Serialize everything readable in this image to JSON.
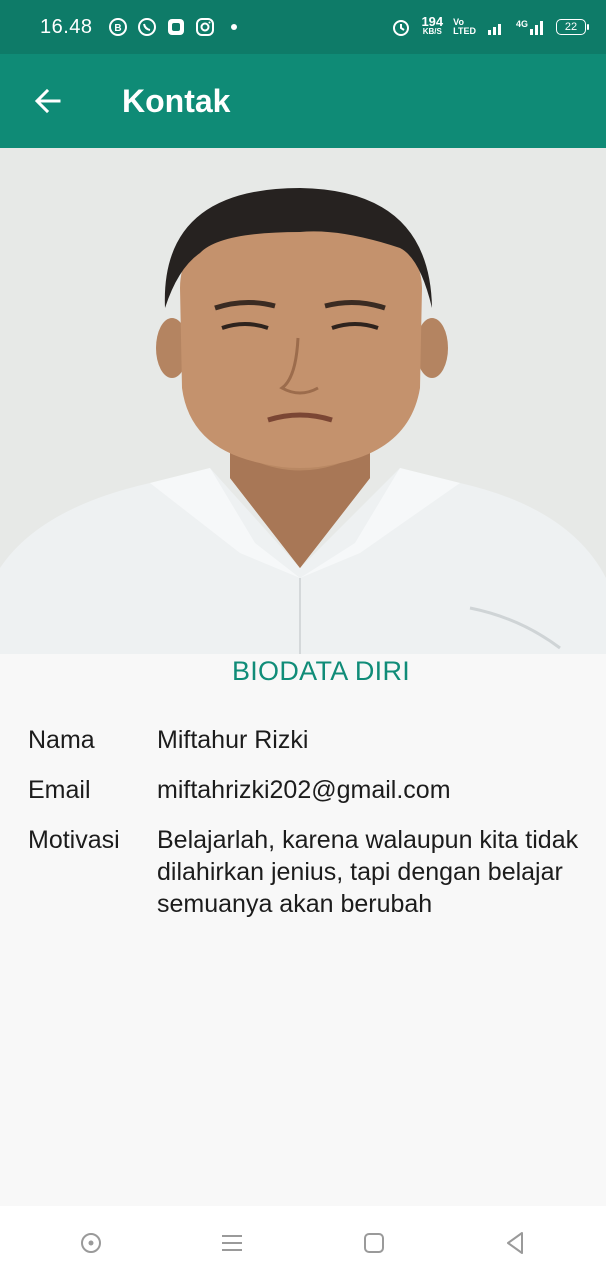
{
  "status_bar": {
    "time": "16.48",
    "net_speed_value": "194",
    "net_speed_unit": "KB/S",
    "volte_top": "Vo",
    "volte_bottom": "LTED",
    "network_type": "4G",
    "battery": "22"
  },
  "app_bar": {
    "title": "Kontak"
  },
  "biodata": {
    "heading": "BIODATA DIRI",
    "rows": [
      {
        "label": "Nama",
        "value": "Miftahur Rizki"
      },
      {
        "label": "Email",
        "value": "miftahrizki202@gmail.com"
      },
      {
        "label": "Motivasi",
        "value": "Belajarlah, karena walaupun kita tidak dilahirkan jenius, tapi dengan belajar semuanya akan berubah"
      }
    ]
  },
  "colors": {
    "status_bar": "#0e7b68",
    "app_bar": "#0f8b76",
    "accent_text": "#108c78"
  }
}
